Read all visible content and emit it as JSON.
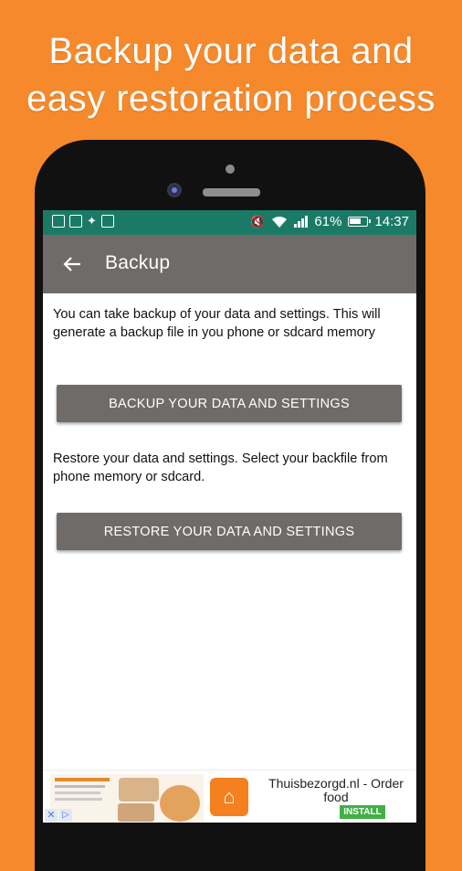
{
  "promo": {
    "line1": "Backup your data and",
    "line2": "easy restoration process"
  },
  "status_bar": {
    "battery_percent": "61%",
    "time": "14:37",
    "icons_left": [
      "nfc-icon",
      "image-icon",
      "dropbox-icon",
      "gallery-icon"
    ],
    "icons_right": [
      "mute-icon",
      "wifi-icon",
      "signal-icon",
      "battery-icon"
    ]
  },
  "app_bar": {
    "title": "Backup",
    "back_icon": "arrow-left-icon"
  },
  "backup_section": {
    "description": "You can take backup of your data and settings. This will generate a backup file in you phone or sdcard memory",
    "button_label": "BACKUP YOUR DATA AND SETTINGS"
  },
  "restore_section": {
    "description": "Restore your data and settings. Select your backfile from phone memory or sdcard.",
    "button_label": "RESTORE YOUR DATA AND SETTINGS"
  },
  "ad": {
    "title": "Thuisbezorgd.nl - Order food",
    "install_label": "INSTALL"
  },
  "colors": {
    "background": "#f5892b",
    "status_bar": "#1b7a66",
    "app_bar": "#6f6b69",
    "button": "#6f6b69",
    "install_button": "#42b046"
  }
}
